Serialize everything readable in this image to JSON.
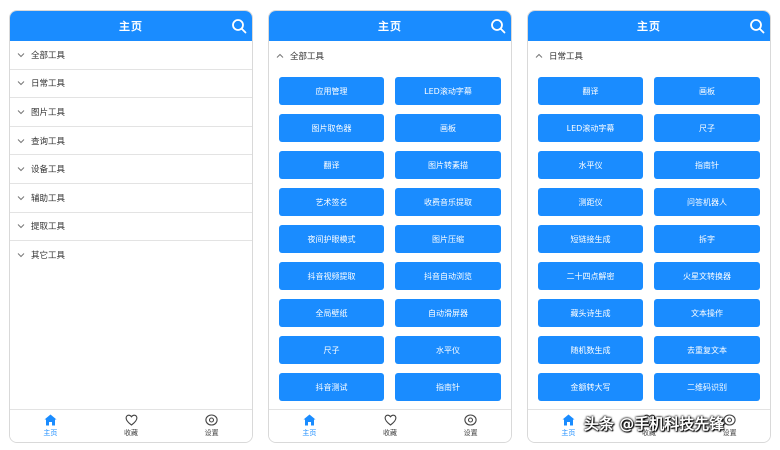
{
  "header": {
    "title": "主页"
  },
  "screen1": {
    "rows": [
      "全部工具",
      "日常工具",
      "图片工具",
      "查询工具",
      "设备工具",
      "辅助工具",
      "提取工具",
      "其它工具"
    ]
  },
  "screen2": {
    "section_title": "全部工具",
    "buttons": [
      "应用管理",
      "LED滚动字幕",
      "图片取色器",
      "画板",
      "翻译",
      "图片转素描",
      "艺术签名",
      "收费音乐提取",
      "夜间护眼模式",
      "图片压缩",
      "抖音视频提取",
      "抖音自动浏览",
      "全局壁纸",
      "自动滑屏器",
      "尺子",
      "水平仪",
      "抖音测试",
      "指南针"
    ]
  },
  "screen3": {
    "section_title": "日常工具",
    "buttons": [
      "翻译",
      "画板",
      "LED滚动字幕",
      "尺子",
      "水平仪",
      "指南针",
      "测距仪",
      "问答机器人",
      "短链接生成",
      "拆字",
      "二十四点解密",
      "火星文转换器",
      "藏头诗生成",
      "文本操作",
      "随机数生成",
      "去重复文本",
      "金额转大写",
      "二维码识别"
    ]
  },
  "tabbar": {
    "home": "主页",
    "favorites": "收藏",
    "settings": "设置"
  },
  "watermark": "头条 @手机科技先锋",
  "colors": {
    "accent": "#1a8cff",
    "divider": "#e3e3e3"
  }
}
